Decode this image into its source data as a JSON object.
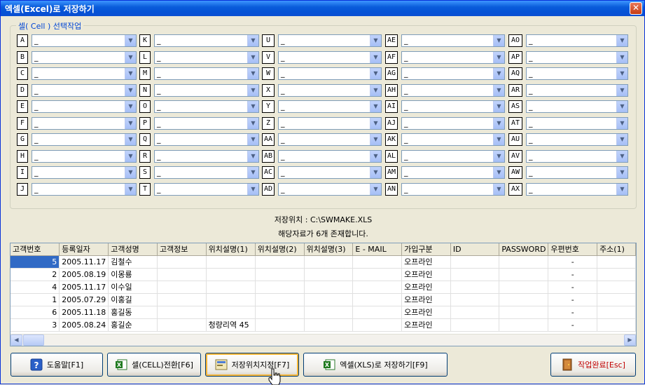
{
  "window": {
    "title": "엑셀(Excel)로 저장하기",
    "close_glyph": "✕"
  },
  "group": {
    "legend": "셀( Cell ) 선택작업"
  },
  "cells": [
    [
      "A",
      "B",
      "C",
      "D",
      "E",
      "F",
      "G",
      "H",
      "I",
      "J"
    ],
    [
      "K",
      "L",
      "M",
      "N",
      "O",
      "P",
      "Q",
      "R",
      "S",
      "T"
    ],
    [
      "U",
      "V",
      "W",
      "X",
      "Y",
      "Z",
      "AA",
      "AB",
      "AC",
      "AD"
    ],
    [
      "AE",
      "AF",
      "AG",
      "AH",
      "AI",
      "AJ",
      "AK",
      "AL",
      "AM",
      "AN"
    ],
    [
      "AO",
      "AP",
      "AQ",
      "AR",
      "AS",
      "AT",
      "AU",
      "AV",
      "AW",
      "AX"
    ]
  ],
  "cell_default_value": "_",
  "info": {
    "save_path": "저장위치 : C:\\SWMAKE.XLS",
    "count_msg": "해당자료가 6개 존재합니다."
  },
  "grid": {
    "columns": [
      "고객번호",
      "등록일자",
      "고객성명",
      "고객정보",
      "위치설명(1)",
      "위치설명(2)",
      "위치설명(3)",
      "E - MAIL",
      "가입구분",
      "ID",
      "PASSWORD",
      "우편번호",
      "주소(1)"
    ],
    "rows": [
      [
        "5",
        "2005.11.17",
        "김철수",
        "",
        "",
        "",
        "",
        "",
        "오프라인",
        "",
        "",
        "-",
        ""
      ],
      [
        "2",
        "2005.08.19",
        "이몽룡",
        "",
        "",
        "",
        "",
        "",
        "오프라인",
        "",
        "",
        "-",
        ""
      ],
      [
        "4",
        "2005.11.17",
        "이수일",
        "",
        "",
        "",
        "",
        "",
        "오프라인",
        "",
        "",
        "-",
        ""
      ],
      [
        "1",
        "2005.07.29",
        "이홍길",
        "",
        "",
        "",
        "",
        "",
        "오프라인",
        "",
        "",
        "-",
        ""
      ],
      [
        "6",
        "2005.11.18",
        "홍길동",
        "",
        "",
        "",
        "",
        "",
        "오프라인",
        "",
        "",
        "-",
        ""
      ],
      [
        "3",
        "2005.08.24",
        "홍길순",
        "",
        "청량리역 45",
        "",
        "",
        "",
        "오프라인",
        "",
        "",
        "-",
        ""
      ]
    ]
  },
  "buttons": {
    "help": "도움말[F1]",
    "cell_convert": "셀(CELL)전환[F6]",
    "save_location": "저장위치지정[F7]",
    "save_excel": "엑셀(XLS)로 저장하기[F9]",
    "finish": "작업완료[Esc]"
  },
  "colors": {
    "titlebar": "#0a5ddb",
    "legend": "#0046d5",
    "finish_text": "#c00000"
  }
}
